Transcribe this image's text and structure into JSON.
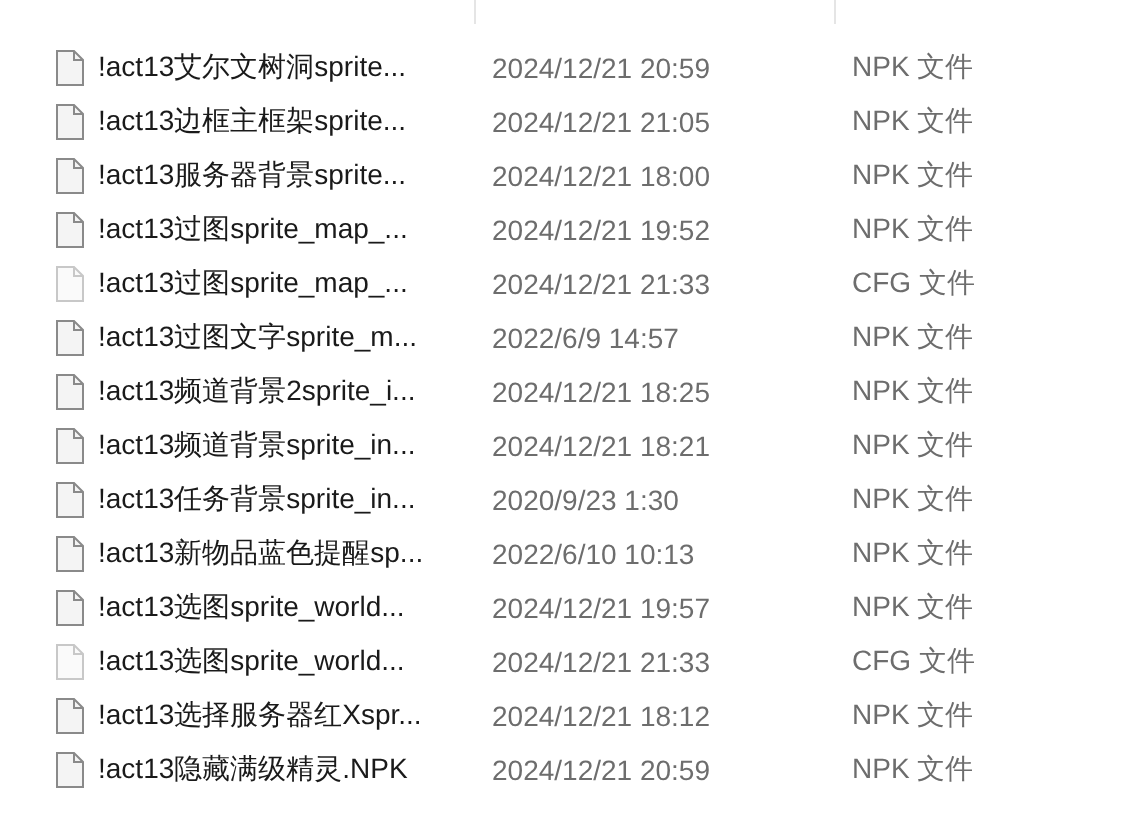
{
  "files": [
    {
      "name": "!act13艾尔文树洞sprite...",
      "modified": "2024/12/21 20:59",
      "type": "NPK 文件",
      "kind": "npk"
    },
    {
      "name": "!act13边框主框架sprite...",
      "modified": "2024/12/21 21:05",
      "type": "NPK 文件",
      "kind": "npk"
    },
    {
      "name": "!act13服务器背景sprite...",
      "modified": "2024/12/21 18:00",
      "type": "NPK 文件",
      "kind": "npk"
    },
    {
      "name": "!act13过图sprite_map_...",
      "modified": "2024/12/21 19:52",
      "type": "NPK 文件",
      "kind": "npk"
    },
    {
      "name": "!act13过图sprite_map_...",
      "modified": "2024/12/21 21:33",
      "type": "CFG 文件",
      "kind": "cfg"
    },
    {
      "name": "!act13过图文字sprite_m...",
      "modified": "2022/6/9 14:57",
      "type": "NPK 文件",
      "kind": "npk"
    },
    {
      "name": "!act13频道背景2sprite_i...",
      "modified": "2024/12/21 18:25",
      "type": "NPK 文件",
      "kind": "npk"
    },
    {
      "name": "!act13频道背景sprite_in...",
      "modified": "2024/12/21 18:21",
      "type": "NPK 文件",
      "kind": "npk"
    },
    {
      "name": "!act13任务背景sprite_in...",
      "modified": "2020/9/23 1:30",
      "type": "NPK 文件",
      "kind": "npk"
    },
    {
      "name": "!act13新物品蓝色提醒sp...",
      "modified": "2022/6/10 10:13",
      "type": "NPK 文件",
      "kind": "npk"
    },
    {
      "name": "!act13选图sprite_world...",
      "modified": "2024/12/21 19:57",
      "type": "NPK 文件",
      "kind": "npk"
    },
    {
      "name": "!act13选图sprite_world...",
      "modified": "2024/12/21 21:33",
      "type": "CFG 文件",
      "kind": "cfg"
    },
    {
      "name": "!act13选择服务器红Xspr...",
      "modified": "2024/12/21 18:12",
      "type": "NPK 文件",
      "kind": "npk"
    },
    {
      "name": "!act13隐藏满级精灵.NPK",
      "modified": "2024/12/21 20:59",
      "type": "NPK 文件",
      "kind": "npk"
    }
  ]
}
